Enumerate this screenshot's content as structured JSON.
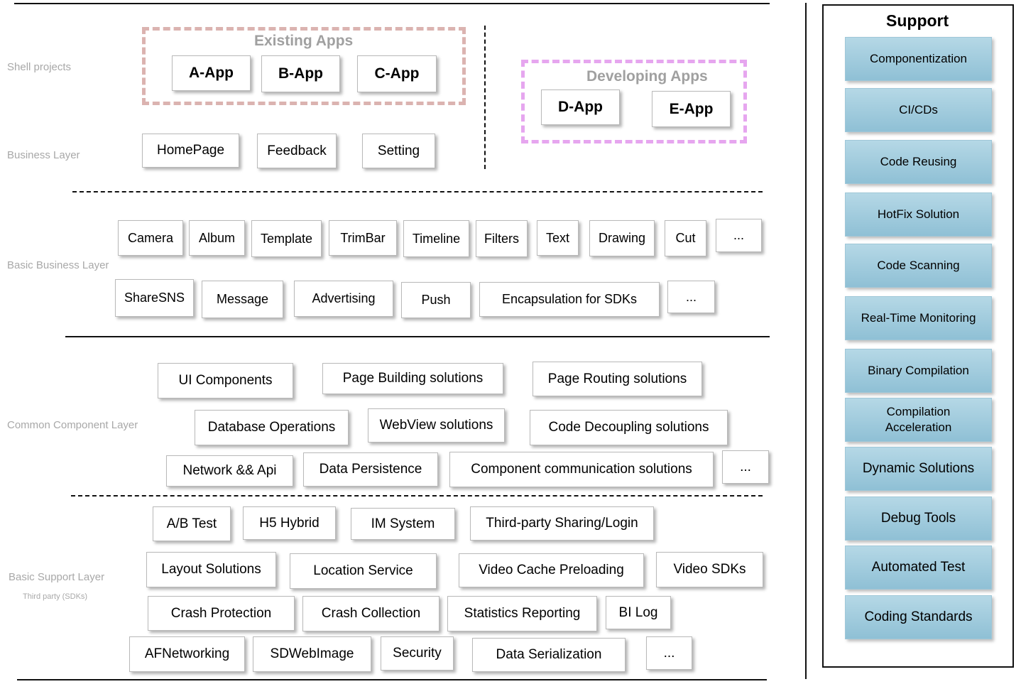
{
  "layers": {
    "shell": "Shell projects",
    "business": "Business Layer",
    "basic_business": "Basic Business Layer",
    "common": "Common Component Layer",
    "basic_support": "Basic Support Layer",
    "basic_support_sub": "Third party (SDKs)"
  },
  "existing_apps": {
    "title": "Existing Apps",
    "items": [
      "A-App",
      "B-App",
      "C-App"
    ]
  },
  "developing_apps": {
    "title": "Developing Apps",
    "items": [
      "D-App",
      "E-App"
    ]
  },
  "business": [
    "HomePage",
    "Feedback",
    "Setting"
  ],
  "basic_business": {
    "row1": [
      "Camera",
      "Album",
      "Template",
      "TrimBar",
      "Timeline",
      "Filters",
      "Text",
      "Drawing",
      "Cut",
      "..."
    ],
    "row2": [
      "ShareSNS",
      "Message",
      "Advertising",
      "Push",
      "Encapsulation for SDKs",
      "..."
    ]
  },
  "common": {
    "row1": [
      "UI Components",
      "Page Building solutions",
      "Page Routing solutions"
    ],
    "row2": [
      "Database Operations",
      "WebView solutions",
      "Code Decoupling solutions"
    ],
    "row3": [
      "Network && Api",
      "Data Persistence",
      "Component communication solutions",
      "..."
    ]
  },
  "basic_support": {
    "row1": [
      "A/B Test",
      "H5 Hybrid",
      "IM System",
      "Third-party Sharing/Login"
    ],
    "row2": [
      "Layout Solutions",
      "Location Service",
      "Video Cache Preloading",
      "Video SDKs"
    ],
    "row3": [
      "Crash Protection",
      "Crash Collection",
      "Statistics Reporting",
      "BI Log"
    ],
    "row4": [
      "AFNetworking",
      "SDWebImage",
      "Security",
      "Data Serialization",
      "..."
    ]
  },
  "support": {
    "title": "Support",
    "items": [
      "Componentization",
      "CI/CDs",
      "Code Reusing",
      "HotFix Solution",
      "Code Scanning",
      "Real-Time Monitoring",
      "Binary Compilation",
      "Compilation\nAcceleration",
      "Dynamic Solutions",
      "Debug Tools",
      "Automated Test",
      "Coding Standards"
    ]
  }
}
